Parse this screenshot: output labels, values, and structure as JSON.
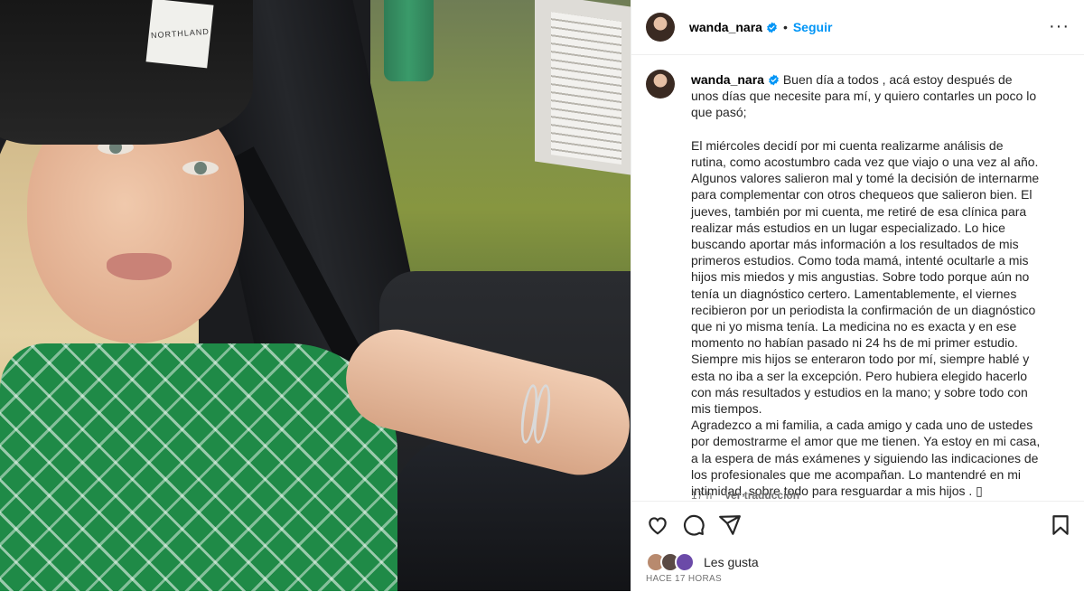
{
  "post": {
    "username": "wanda_nara",
    "follow_label": "Seguir",
    "separator": "•",
    "more_label": "···",
    "beanie_text": "NORTHLAND",
    "caption_intro": "Buen día a todos , acá estoy después de unos días que necesite para mí, y quiero contarles un poco lo que pasó;",
    "caption_para1": "El miércoles decidí por mi cuenta realizarme análisis de rutina, como acostumbro cada vez que viajo o una vez al año. Algunos valores salieron mal y tomé la decisión de internarme para complementar con otros chequeos que salieron bien. El jueves, también por mi cuenta, me retiré de esa clínica para realizar más estudios en un lugar especializado. Lo hice buscando aportar más información a los resultados de mis primeros estudios. Como toda mamá, intenté ocultarle a mis hijos mis miedos y mis angustias. Sobre todo porque aún no tenía un diagnóstico certero. Lamentablemente, el viernes recibieron por un periodista la confirmación de un diagnóstico que ni yo misma tenía. La medicina no es exacta y en ese momento no habían pasado ni 24 hs de mi primer estudio. Siempre mis hijos se enteraron todo por mí, siempre hablé y esta no iba a ser la excepción. Pero hubiera elegido hacerlo con más resultados y estudios en la mano; y sobre todo con mis tiempos.",
    "caption_para2": "Agradezco a mi familia, a cada amigo y cada uno de ustedes por demostrarme el amor que me tienen. Ya estoy en mi casa, a la espera de más exámenes y siguiendo las indicaciones de los profesionales que me acompañan. Lo mantendré en mi intimidad, sobre todo para resguardar a mis hijos . ",
    "caption_end_glyph": "▯",
    "caption_time": "17 h",
    "translate_label": "Ver traducción",
    "likes_label": "Les gusta",
    "timestamp": "HACE 17 HORAS"
  },
  "colors": {
    "accent": "#0095f6",
    "text": "#262626",
    "muted": "#737373",
    "border": "#efefef"
  },
  "icons": [
    "verified-badge-icon",
    "more-options-icon",
    "heart-icon",
    "comment-icon",
    "share-icon",
    "bookmark-icon"
  ]
}
